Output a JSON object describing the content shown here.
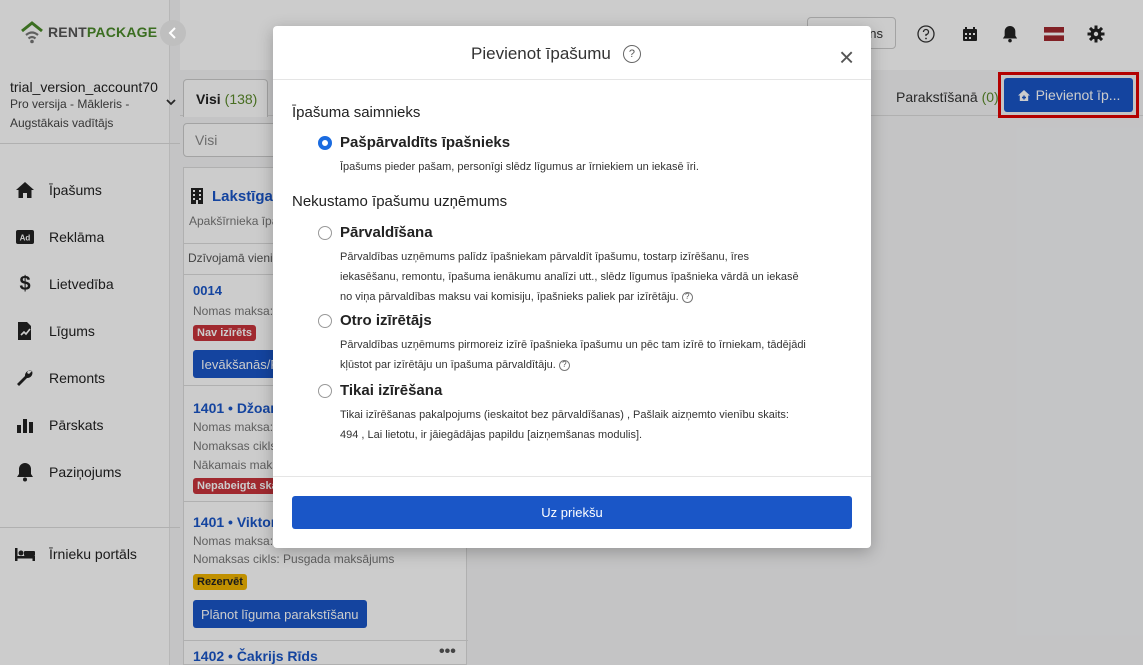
{
  "brand": {
    "logo_prefix": "RENT",
    "logo_suffix": "PACKAGE"
  },
  "account": {
    "name": "trial_version_account70",
    "meta": "Pro versija - Mākleris - Augstākais vadītājs"
  },
  "sidebar": {
    "items": [
      {
        "label": "Īpašums",
        "icon": "home-icon"
      },
      {
        "label": "Reklāma",
        "icon": "ad-icon"
      },
      {
        "label": "Lietvedība",
        "icon": "dollar-icon"
      },
      {
        "label": "Līgums",
        "icon": "contract-icon"
      },
      {
        "label": "Remonts",
        "icon": "wrench-icon"
      },
      {
        "label": "Pārskats",
        "icon": "bar-chart-icon"
      },
      {
        "label": "Paziņojums",
        "icon": "bell-icon"
      }
    ],
    "tenant_portal": "Īrnieku portāls"
  },
  "topbar": {
    "partial_button": "ns"
  },
  "tabs": {
    "all_label": "Visi",
    "all_count": "(138)",
    "sign_label": "Parakstīšanā",
    "sign_count": "(0)"
  },
  "add_property_button": "Pievienot īp...",
  "filter": {
    "value": "Visi"
  },
  "list": {
    "group_title": "Lakstīgal",
    "group_sub": "Apakšīrnieka īpa",
    "section": "Dzīvojamā vieni",
    "items": [
      {
        "title": "0014",
        "rows": [
          "Nomas maksa:"
        ],
        "badge": "Nav izīrēts",
        "button": "Ievākšanās/Pa"
      },
      {
        "title": "1401 • Džoan",
        "rows": [
          "Nomas maksa:",
          "Nomaksas cikls",
          "Nākamais maks"
        ],
        "badge": "Nepabeigta ska"
      },
      {
        "title": "1401 • Viktors",
        "rows": [
          "Nomas maksa:",
          "Nomaksas cikls: Pusgada maksājums"
        ],
        "badge": "Rezervēt",
        "button": "Plānot līguma parakstīšanu"
      },
      {
        "title": "1402 • Čakrijs Rīds",
        "dots": "•••"
      }
    ]
  },
  "modal": {
    "title": "Pievienot īpašumu",
    "help": "?",
    "close": "×",
    "section1": "Īpašuma saimnieks",
    "section2": "Nekustamo īpašumu uzņēmums",
    "options": [
      {
        "label": "Pašpārvaldīts īpašnieks",
        "desc": "Īpašums pieder pašam, personīgi slēdz līgumus ar īrniekiem un iekasē īri.",
        "selected": true
      },
      {
        "label": "Pārvaldīšana",
        "desc": "Pārvaldības uzņēmums palīdz īpašniekam pārvaldīt īpašumu, tostarp izīrēšanu, īres iekasēšanu, remontu, īpašuma ienākumu analīzi utt., slēdz līgumus īpašnieka vārdā un iekasē no viņa pārvaldības maksu vai komisiju, īpašnieks paliek par izīrētāju.",
        "selected": false
      },
      {
        "label": "Otro izīrētājs",
        "desc": "Pārvaldības uzņēmums pirmoreiz izīrē īpašnieka īpašumu un pēc tam izīrē to īrniekam, tādējādi kļūstot par izīrētāju un īpašuma pārvaldītāju.",
        "selected": false
      },
      {
        "label": "Tikai izīrēšana",
        "desc": "Tikai izīrēšanas pakalpojums (ieskaitot bez pārvaldīšanas) , Pašlaik aizņemto vienību skaits: 494 , Lai lietotu, ir jāiegādājas papildu [aizņemšanas modulis].",
        "selected": false
      }
    ],
    "next_button": "Uz priekšu"
  }
}
